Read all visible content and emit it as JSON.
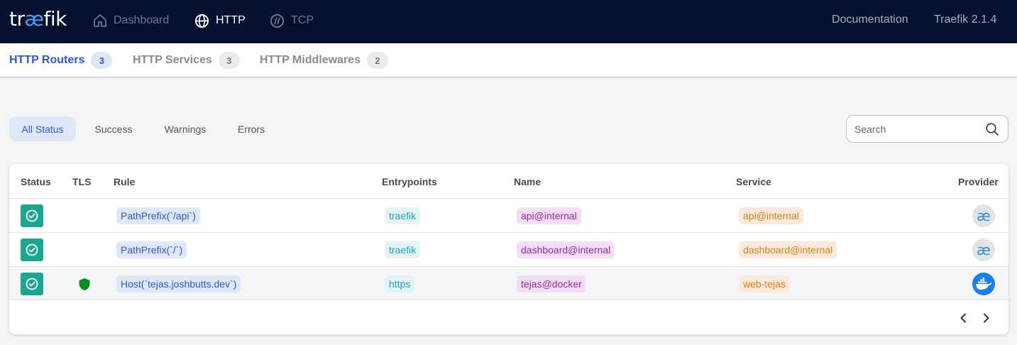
{
  "app": {
    "logo_pre": "tr",
    "logo_ae": "æ",
    "logo_post": "fik"
  },
  "topnav": {
    "items": [
      {
        "label": "Dashboard",
        "icon": "home-icon"
      },
      {
        "label": "HTTP",
        "icon": "globe-icon"
      },
      {
        "label": "TCP",
        "icon": "tcp-icon"
      }
    ],
    "documentation": "Documentation",
    "version": "Traefik 2.1.4"
  },
  "subtabs": [
    {
      "label": "HTTP Routers",
      "count": "3"
    },
    {
      "label": "HTTP Services",
      "count": "3"
    },
    {
      "label": "HTTP Middlewares",
      "count": "2"
    }
  ],
  "filters": [
    "All Status",
    "Success",
    "Warnings",
    "Errors"
  ],
  "search": {
    "placeholder": "Search"
  },
  "table": {
    "headers": [
      "Status",
      "TLS",
      "Rule",
      "Entrypoints",
      "Name",
      "Service",
      "Provider"
    ],
    "rows": [
      {
        "status": "success",
        "tls": false,
        "rule": "PathPrefix(`/api`)",
        "entrypoint": "traefik",
        "name": "api@internal",
        "service": "api@internal",
        "provider": "internal"
      },
      {
        "status": "success",
        "tls": false,
        "rule": "PathPrefix(`/`)",
        "entrypoint": "traefik",
        "name": "dashboard@internal",
        "service": "dashboard@internal",
        "provider": "internal"
      },
      {
        "status": "success",
        "tls": true,
        "rule": "Host(`tejas.joshbutts.dev`)",
        "entrypoint": "https",
        "name": "tejas@docker",
        "service": "web-tejas",
        "provider": "docker"
      }
    ],
    "provider_internal_glyph": "æ"
  },
  "colors": {
    "topbar": "#03102e",
    "accent": "#2c58c7",
    "success": "#1aa792",
    "tls": "#0f8a1f"
  }
}
